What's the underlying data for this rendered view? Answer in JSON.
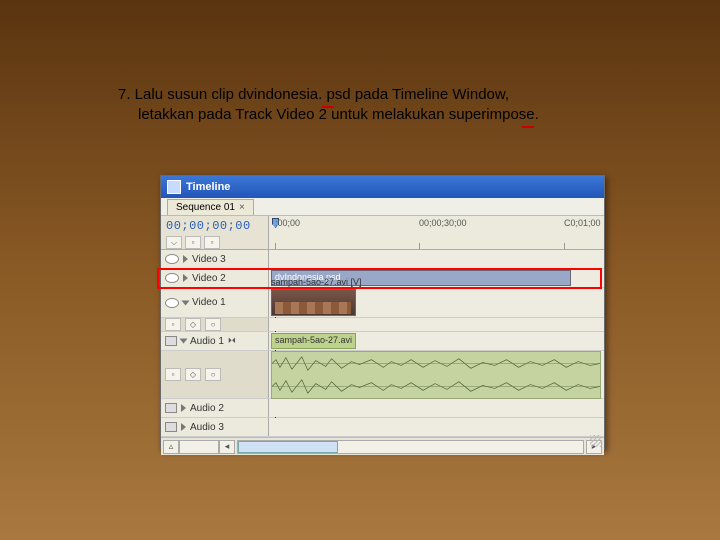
{
  "caption": {
    "line1": "7. Lalu susun clip dvindonesia. psd pada Timeline Window,",
    "line2": "letakkan pada Track Video 2 untuk melakukan superimpose."
  },
  "window": {
    "title": "Timeline",
    "tab": "Sequence 01",
    "timecode": "00;00;00;00",
    "ruler": {
      "t0": ";00;00",
      "t1": "00;00;30;00",
      "t2": "C0;01;00"
    },
    "tracks": {
      "video3": "Video 3",
      "video2": "Video 2",
      "video1": "Video 1",
      "audio1": "Audio 1",
      "audio2": "Audio 2",
      "audio3": "Audio 3"
    },
    "clips": {
      "vid2": "dvIndonesia.psd",
      "vid1_label": "sampah-5ao-27.avi [V]",
      "aud1": "sampah-5ao-27.avi [A]"
    }
  }
}
